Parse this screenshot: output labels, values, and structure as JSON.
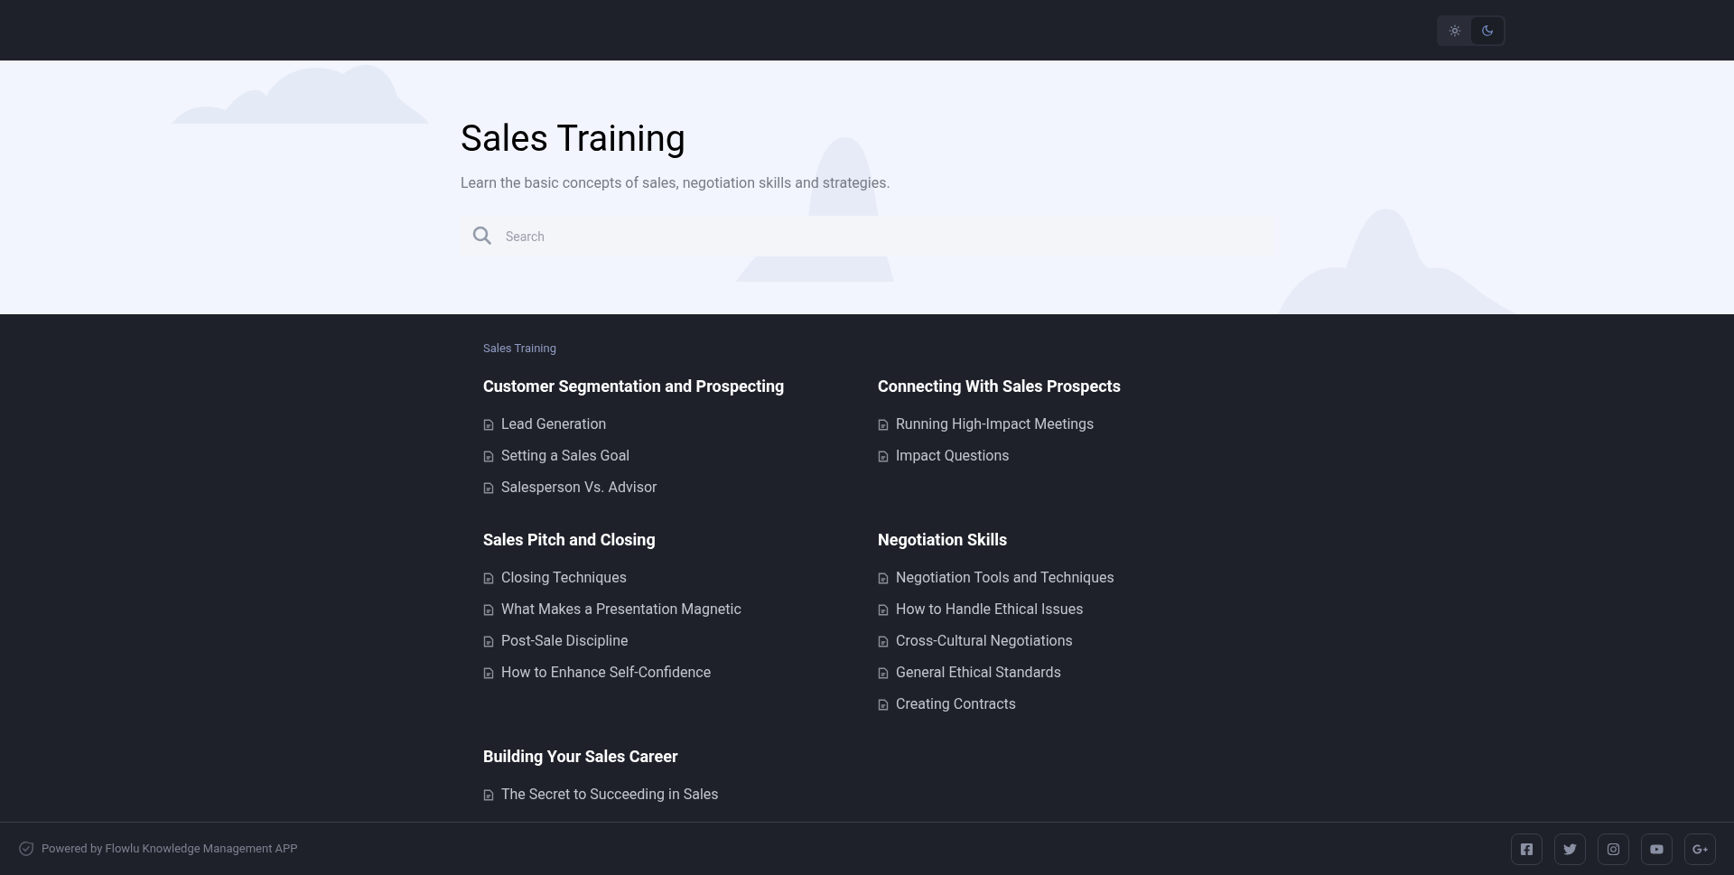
{
  "theme_toggle": [
    {
      "kind": "light",
      "selected": false
    },
    {
      "kind": "dark",
      "selected": true
    }
  ],
  "hero": {
    "title": "Sales Training",
    "subtitle": "Learn the basic concepts of sales, negotiation skills and strategies.",
    "search": {
      "placeholder": "Search"
    }
  },
  "breadcrumb": "Sales Training",
  "sections": [
    {
      "title": "Customer Segmentation and Prospecting",
      "articles": [
        "Lead Generation",
        "Setting a Sales Goal",
        "Salesperson Vs. Advisor"
      ]
    },
    {
      "title": "Connecting With Sales Prospects",
      "articles": [
        "Running High-Impact Meetings",
        "Impact Questions"
      ]
    },
    {
      "title": "Sales Pitch and Closing",
      "articles": [
        "Closing Techniques",
        "What Makes a Presentation Magnetic",
        "Post-Sale Discipline",
        "How to Enhance Self-Confidence"
      ]
    },
    {
      "title": "Negotiation Skills",
      "articles": [
        "Negotiation Tools and Techniques",
        "How to Handle Ethical Issues",
        "Cross-Cultural Negotiations",
        "General Ethical Standards",
        "Creating Contracts"
      ]
    },
    {
      "title": "Building Your Sales Career",
      "articles": [
        "The Secret to Succeeding in Sales"
      ]
    }
  ],
  "footer": {
    "powered_by": "Powered by Flowlu Knowledge Management APP",
    "social": [
      {
        "kind": "facebook"
      },
      {
        "kind": "twitter"
      },
      {
        "kind": "instagram"
      },
      {
        "kind": "youtube"
      },
      {
        "kind": "googleplus"
      }
    ]
  }
}
